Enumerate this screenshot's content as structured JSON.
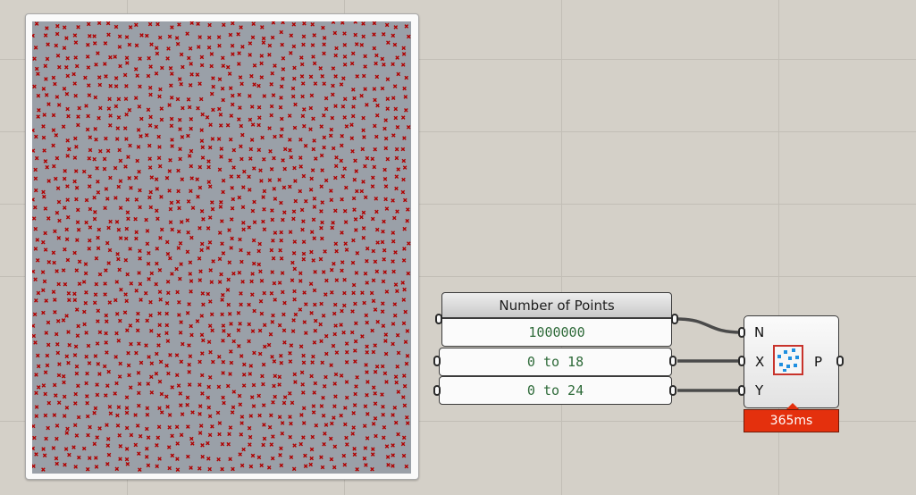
{
  "canvas": {
    "background": "#d4d0c8",
    "grid_color": "#c2beb6"
  },
  "viewport": {
    "background": "#9aa0a8",
    "point_color": "#b00000",
    "point_marker": "x-cross"
  },
  "slider_group": {
    "title": "Number of Points",
    "count_value": "1000000",
    "x_range": "0 to 18",
    "y_range": "0 to 24"
  },
  "component": {
    "inputs": [
      "N",
      "X",
      "Y"
    ],
    "outputs": [
      "P"
    ],
    "icon": "random-points-icon",
    "icon_border_color": "#c8332b",
    "icon_dot_color": "#1f8fe0"
  },
  "profiler": {
    "time": "365ms",
    "color": "#e4300d"
  }
}
